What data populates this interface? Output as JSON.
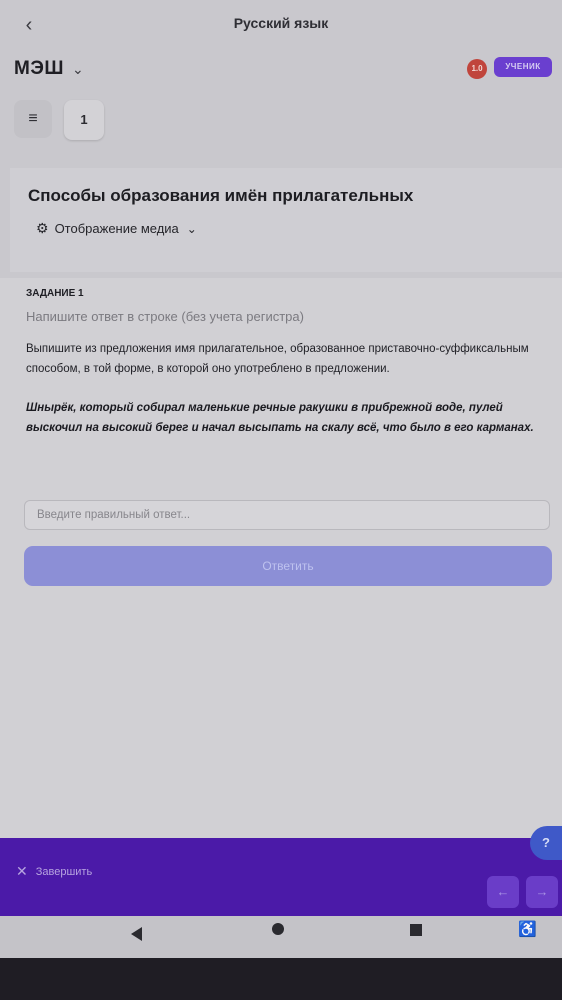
{
  "topbar": {
    "back_icon": "chevron-left-icon",
    "title": "Русский язык"
  },
  "brand": {
    "name": "МЭШ",
    "dropdown_icon": "chevron-down-icon"
  },
  "user": {
    "avatar_initials": "1.0",
    "role": "УЧЕНИК",
    "avatar_color": "#c0453c",
    "role_color": "#6a3fcf"
  },
  "toolbar": {
    "menu_icon": "hamburger-icon",
    "task_number": "1"
  },
  "lesson": {
    "title": "Способы образования имён прилагательных",
    "media_toggle": "Отображение медиа",
    "media_icon": "gear-icon"
  },
  "task": {
    "label": "ЗАДАНИЕ 1",
    "hint": "Напишите ответ в строке (без учета регистра)",
    "instruction": "Выпишите из предложения имя прилагательное, образованное приставочно-суффиксальным способом, в той форме, в которой оно употреблено в предложении.",
    "sentence": "Шнырёк, который собирал маленькие речные ракушки в прибрежной воде, пулей выскочил на высокий берег и начал высыпать на скалу всё, что было в  его карманах.",
    "answer_value": "",
    "answer_placeholder": "Введите правильный ответ...",
    "submit_label": "Ответить",
    "submit_color": "#8c8fd6"
  },
  "help": {
    "label": "?"
  },
  "footer": {
    "finish_label": "Завершить",
    "finish_icon": "close-icon",
    "prev_icon": "arrow-left-icon",
    "next_icon": "arrow-right-icon",
    "bar_color": "#4b1aa8"
  },
  "system_nav": [
    "back-triangle-icon",
    "home-circle-icon",
    "recent-square-icon",
    "accessibility-icon"
  ]
}
